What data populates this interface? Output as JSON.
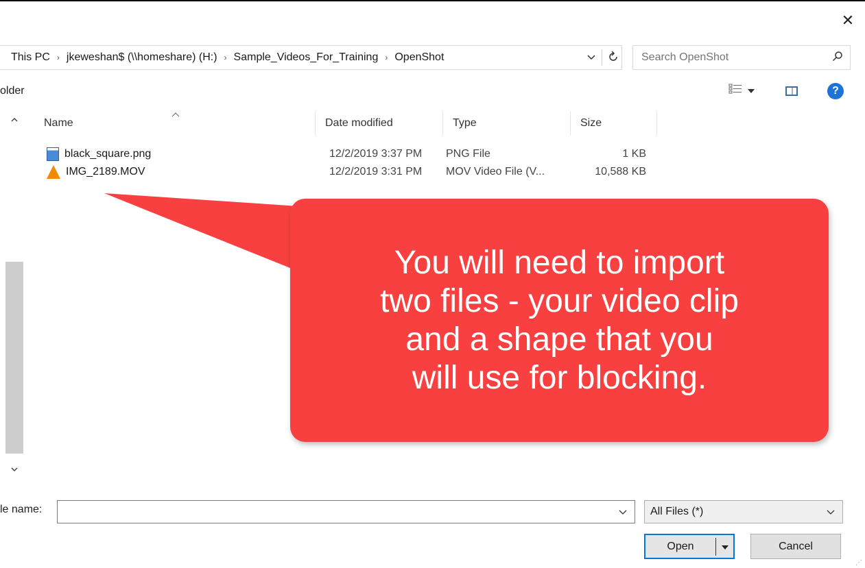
{
  "window": {
    "close_glyph": "✕"
  },
  "breadcrumb": {
    "items": [
      "This PC",
      "jkeweshan$ (\\\\homeshare) (H:)",
      "Sample_Videos_For_Training",
      "OpenShot"
    ],
    "separator": "›",
    "dropdown_icon": "chevron-down-icon",
    "refresh_icon": "refresh-icon"
  },
  "search": {
    "placeholder": "Search OpenShot",
    "icon": "search-icon"
  },
  "toolbar": {
    "new_folder_label": "older",
    "help_glyph": "?"
  },
  "file_list": {
    "columns": [
      "Name",
      "Date modified",
      "Type",
      "Size"
    ],
    "rows": [
      {
        "name": "black_square.png",
        "date": "12/2/2019 3:37 PM",
        "type": "PNG File",
        "size": "1 KB",
        "icon": "png-file-icon"
      },
      {
        "name": "IMG_2189.MOV",
        "date": "12/2/2019 3:31 PM",
        "type": "MOV Video File (V...",
        "size": "10,588 KB",
        "icon": "vlc-icon"
      }
    ]
  },
  "callout": {
    "text": "You will need to import\ntwo files - your video clip\nand a shape that you\nwill use for blocking.",
    "color": "#f84040"
  },
  "bottom": {
    "filename_label": "le name:",
    "filename_value": "",
    "filter_value": "All Files  (*)",
    "open_label": "Open",
    "cancel_label": "Cancel"
  },
  "colors": {
    "accent": "#0078d7",
    "help": "#1e73d9"
  }
}
